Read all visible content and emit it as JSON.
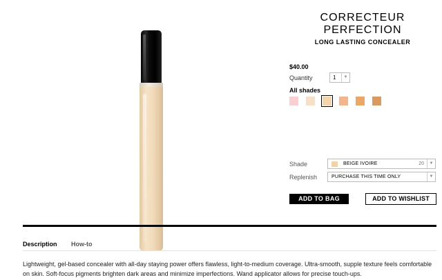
{
  "product": {
    "title": "CORRECTEUR PERFECTION",
    "subtitle": "LONG LASTING CONCEALER",
    "price": "$40.00"
  },
  "quantity": {
    "label": "Quantity",
    "value": "1"
  },
  "shades": {
    "label": "All shades",
    "swatches": [
      {
        "color": "#f9cfd4"
      },
      {
        "color": "#f6e0c8"
      },
      {
        "color": "#f2d5a8",
        "selected": true
      },
      {
        "color": "#f3b58c"
      },
      {
        "color": "#eaa768"
      },
      {
        "color": "#d99a60"
      }
    ]
  },
  "shade_field": {
    "label": "Shade",
    "selected_name": "BEIGE IVOIRE",
    "selected_number": "20",
    "chip_color": "#f2d3a6"
  },
  "replenish_field": {
    "label": "Replenish",
    "selected": "PURCHASE THIS TIME ONLY"
  },
  "actions": {
    "add_to_bag": "ADD TO BAG",
    "add_to_wishlist": "ADD TO WISHLIST"
  },
  "tabs": [
    {
      "label": "Description",
      "active": true
    },
    {
      "label": "How-to",
      "active": false
    }
  ],
  "description": "Lightweight, gel-based concealer with all-day staying power offers flawless, light-to-medium coverage. Ultra-smooth, supple texture feels comfortable on skin. Soft-focus pigments brighten dark areas and minimize imperfections. Wand applicator allows for precise touch-ups."
}
